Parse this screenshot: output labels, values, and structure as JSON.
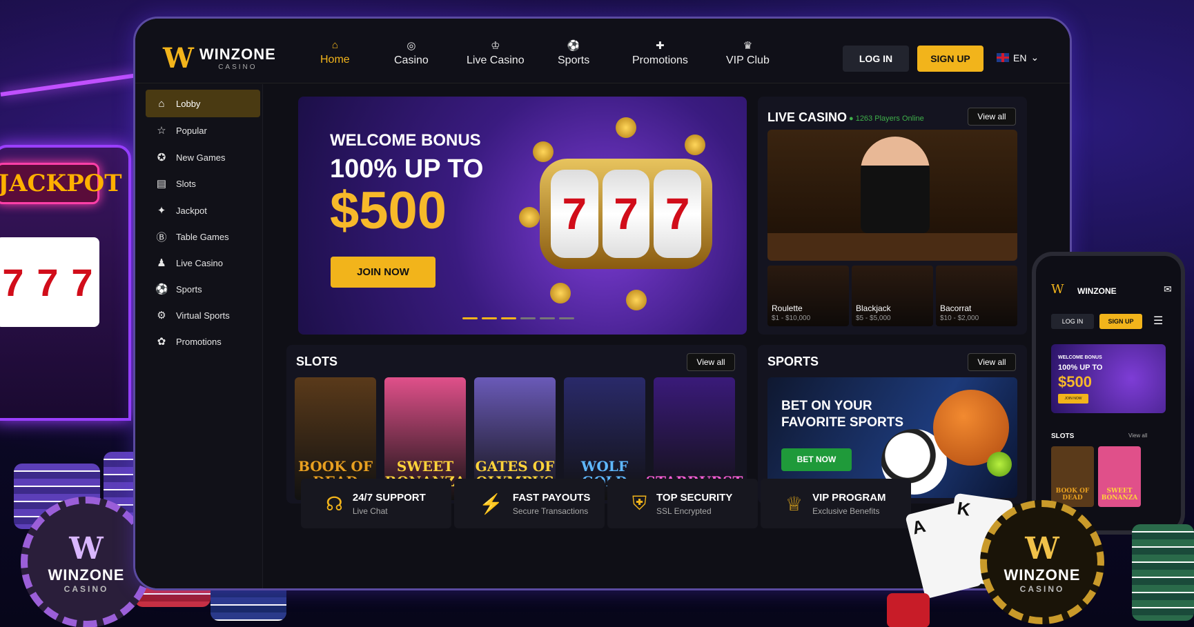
{
  "decor": {
    "jackpot_sign": "JACKPOT",
    "reel_symbols": [
      "7",
      "7",
      "7"
    ],
    "chip_left": {
      "mark": "W",
      "name": "WINZONE",
      "sub": "CASINO"
    },
    "chip_right": {
      "mark": "W",
      "name": "WINZONE",
      "sub": "CASINO"
    },
    "card1": "A",
    "card2": "K"
  },
  "header": {
    "logo_mark": "W",
    "logo_title": "WINZONE",
    "logo_sub": "CASINO",
    "nav": [
      {
        "label": "Home",
        "icon": "⌂"
      },
      {
        "label": "Casino",
        "icon": "◎"
      },
      {
        "label": "Live Casino",
        "icon": "♔"
      },
      {
        "label": "Sports",
        "icon": "⚽"
      },
      {
        "label": "Promotions",
        "icon": "✚"
      },
      {
        "label": "VIP Club",
        "icon": "♛"
      }
    ],
    "login": "LOG IN",
    "signup": "SIGN UP",
    "language": "EN",
    "lang_caret": "⌄"
  },
  "sidebar": {
    "items": [
      {
        "label": "Lobby",
        "icon": "⌂"
      },
      {
        "label": "Popular",
        "icon": "☆"
      },
      {
        "label": "New Games",
        "icon": "✪"
      },
      {
        "label": "Slots",
        "icon": "▤"
      },
      {
        "label": "Jackpot",
        "icon": "✦"
      },
      {
        "label": "Table Games",
        "icon": "Ⓑ"
      },
      {
        "label": "Live Casino",
        "icon": "♟"
      },
      {
        "label": "Sports",
        "icon": "⚽"
      },
      {
        "label": "Virtual Sports",
        "icon": "⚙"
      },
      {
        "label": "Promotions",
        "icon": "✿"
      }
    ]
  },
  "hero": {
    "line1": "WELCOME BONUS",
    "line2": "100% UP TO",
    "amount": "$500",
    "cta": "JOIN NOW",
    "reels": [
      "7",
      "7",
      "7"
    ],
    "slides": 6,
    "active_slide": 2
  },
  "live_casino": {
    "title": "LIVE CASINO",
    "players": "● 1263 Players Online",
    "view_all": "View all",
    "tables": [
      {
        "name": "Roulette",
        "limit": "$1 - $10,000"
      },
      {
        "name": "Blackjack",
        "limit": "$5 - $5,000"
      },
      {
        "name": "Bacorrat",
        "limit": "$10 - $2,000"
      }
    ]
  },
  "slots": {
    "title": "SLOTS",
    "view_all": "View all",
    "games": [
      {
        "name": "BOOK OF DEAD",
        "bg": "#5a3a1a",
        "fg": "#e8a020"
      },
      {
        "name": "SWEET BONANZA",
        "bg": "#e0508a",
        "fg": "#ffd33a"
      },
      {
        "name": "GATES OF OLYMPUS",
        "bg": "#6a5ab8",
        "fg": "#ffd33a"
      },
      {
        "name": "WOLF GOLD",
        "bg": "#2a2a6a",
        "fg": "#5fb8ff"
      },
      {
        "name": "STARBURST",
        "bg": "#3a1a7a",
        "fg": "#ff5fd8"
      }
    ]
  },
  "sports": {
    "title": "SPORTS",
    "view_all": "View all",
    "headline1": "BET ON YOUR",
    "headline2": "FAVORITE SPORTS",
    "cta": "BET NOW"
  },
  "features": [
    {
      "icon": "☊",
      "title": "24/7 SUPPORT",
      "sub": "Live Chat"
    },
    {
      "icon": "⚡",
      "title": "FAST PAYOUTS",
      "sub": "Secure Transactions"
    },
    {
      "icon": "⛨",
      "title": "TOP SECURITY",
      "sub": "SSL Encrypted"
    },
    {
      "icon": "♕",
      "title": "VIP PROGRAM",
      "sub": "Exclusive Benefits"
    }
  ],
  "phone": {
    "logo_mark": "W",
    "logo": "WINZONE",
    "menu_icon": "✉",
    "login": "LOG IN",
    "signup": "SIGN UP",
    "hamburger": "☰",
    "hero1": "WELCOME BONUS",
    "hero2": "100% UP TO",
    "hero3": "$500",
    "hero_cta": "JOIN NOW",
    "slots": "SLOTS",
    "view_all": "View all",
    "games": [
      "BOOK OF DEAD",
      "SWEET BONANZA"
    ]
  },
  "colors": {
    "accent": "#f2b41b",
    "green": "#1f9a3a"
  }
}
